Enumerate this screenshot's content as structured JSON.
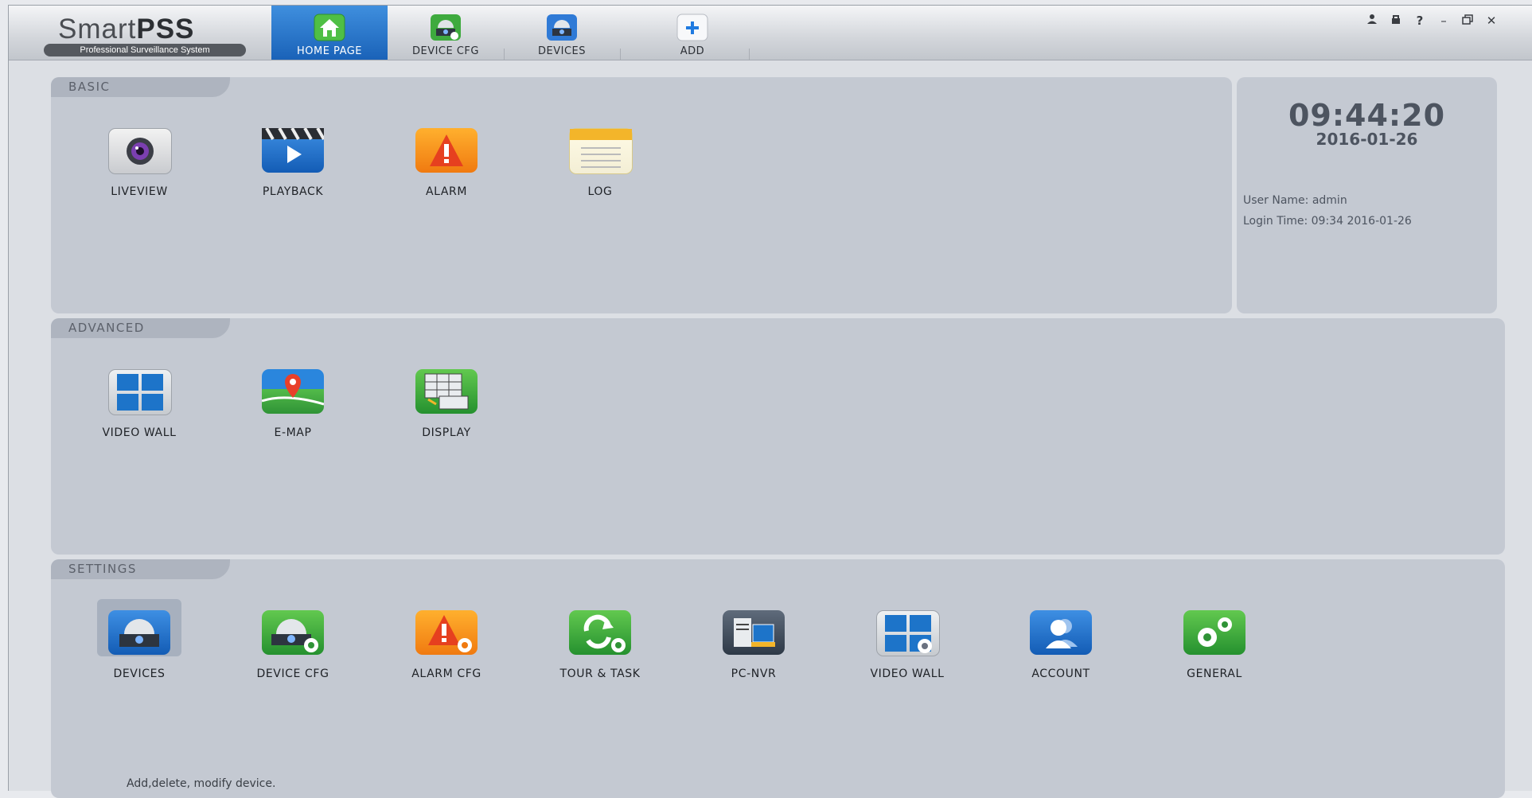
{
  "app": {
    "logo_word_1": "Smart",
    "logo_word_2": "PSS",
    "logo_tagline": "Professional Surveillance System"
  },
  "tabs": [
    {
      "label": "HOME PAGE",
      "icon": "home-icon",
      "active": true
    },
    {
      "label": "DEVICE CFG",
      "icon": "device-cfg-icon",
      "active": false
    },
    {
      "label": "DEVICES",
      "icon": "devices-icon",
      "active": false
    },
    {
      "label": "ADD",
      "icon": "add-icon",
      "active": false
    }
  ],
  "window_controls": {
    "user": "👤",
    "lock": "🔒",
    "help": "?",
    "minimize": "–",
    "restore": "🗗",
    "close": "✕"
  },
  "basic": {
    "title": "BASIC",
    "items": [
      {
        "label": "LIVEVIEW",
        "icon": "liveview-camera-icon"
      },
      {
        "label": "PLAYBACK",
        "icon": "playback-clapper-icon"
      },
      {
        "label": "ALARM",
        "icon": "alarm-warning-icon"
      },
      {
        "label": "LOG",
        "icon": "log-notepad-icon"
      }
    ]
  },
  "info": {
    "time": "09:44:20",
    "date": "2016-01-26",
    "user_name": "User Name: admin",
    "login_time": "Login Time: 09:34 2016-01-26"
  },
  "advanced": {
    "title": "ADVANCED",
    "items": [
      {
        "label": "VIDEO WALL",
        "icon": "video-wall-icon"
      },
      {
        "label": "E-MAP",
        "icon": "emap-pin-icon"
      },
      {
        "label": "DISPLAY",
        "icon": "display-grid-icon"
      }
    ]
  },
  "settings": {
    "title": "SETTINGS",
    "items": [
      {
        "label": "DEVICES",
        "icon": "devices-camera-icon",
        "selected": true
      },
      {
        "label": "DEVICE CFG",
        "icon": "device-cfg-gear-icon"
      },
      {
        "label": "ALARM CFG",
        "icon": "alarm-cfg-icon"
      },
      {
        "label": "TOUR & TASK",
        "icon": "tour-task-icon"
      },
      {
        "label": "PC-NVR",
        "icon": "pc-nvr-icon"
      },
      {
        "label": "VIDEO WALL",
        "icon": "video-wall-cfg-icon"
      },
      {
        "label": "ACCOUNT",
        "icon": "account-icon"
      },
      {
        "label": "GENERAL",
        "icon": "general-gears-icon"
      }
    ],
    "description": "Add,delete, modify device."
  },
  "colors": {
    "accent_tab": "#1a62b8",
    "panel_bg": "#c4c9d2"
  }
}
